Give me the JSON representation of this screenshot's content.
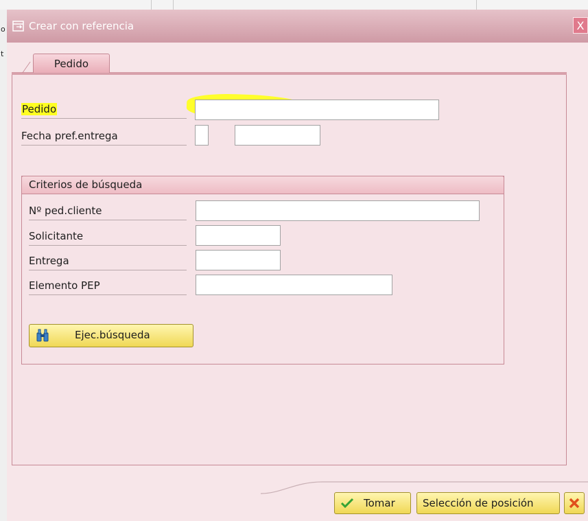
{
  "background": {
    "left_fragments": [
      "o",
      "t"
    ]
  },
  "window": {
    "title": "Crear con referencia",
    "title_icon": "window-icon",
    "close_label": "X"
  },
  "tabs": [
    {
      "label": "Pedido",
      "active": true
    }
  ],
  "fields": {
    "pedido": {
      "label": "Pedido",
      "value": "",
      "highlighted": true
    },
    "fecha_pref_entrega": {
      "label": "Fecha pref.entrega",
      "value_small": "",
      "value_date": ""
    }
  },
  "search_group": {
    "title": "Criterios de búsqueda",
    "fields": [
      {
        "label": "Nº ped.cliente",
        "value": ""
      },
      {
        "label": "Solicitante",
        "value": ""
      },
      {
        "label": "Entrega",
        "value": ""
      },
      {
        "label": "Elemento PEP",
        "value": ""
      }
    ],
    "search_button": {
      "label": "Ejec.búsqueda",
      "icon": "binoculars-icon"
    }
  },
  "footer": {
    "buttons": [
      {
        "label": "Tomar",
        "icon": "checkmark-icon"
      },
      {
        "label": "Selección de posición"
      },
      {
        "label": "",
        "icon": "cancel-icon"
      }
    ]
  },
  "colors": {
    "highlight": "#ffff22",
    "title_bar": "#d9a9b3",
    "panel": "#f6e3e7",
    "button": "#f3dd66"
  }
}
